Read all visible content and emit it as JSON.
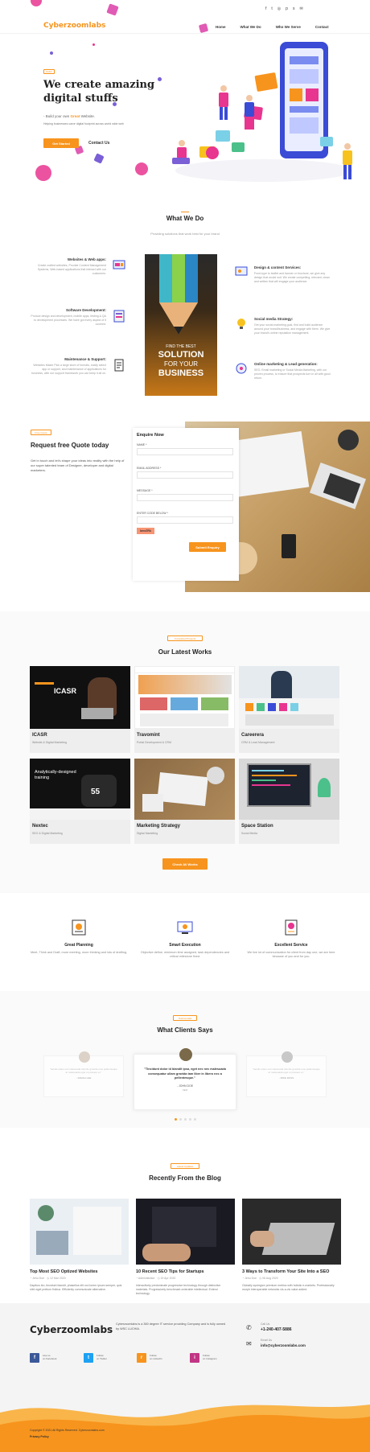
{
  "header": {
    "logo": "Cyberzoomlabs",
    "nav": [
      "Home",
      "What We Do",
      "Who We Serve",
      "Contact"
    ],
    "social_icons": [
      "facebook-icon",
      "twitter-icon",
      "instagram-icon",
      "pinterest-icon",
      "skype-icon",
      "email-icon"
    ]
  },
  "hero": {
    "tag": "Hello!",
    "title_line1": "We create amazing",
    "title_line2": "digital stuffs",
    "subtitle_prefix": "- Build your own",
    "subtitle_highlight": "Great",
    "subtitle_suffix": "Website.",
    "description": "Helping businesses carve digital footprint across world wide web",
    "cta_primary": "Get Started",
    "cta_secondary": "Contact Us"
  },
  "what_we_do": {
    "title": "What We Do",
    "subtitle": "Providing solutions that work best for your brand",
    "image_text": [
      "FIND THE BEST",
      "SOLUTION",
      "FOR YOUR",
      "BUSINESS"
    ],
    "left_services": [
      {
        "title": "Websites & Web apps:",
        "desc": "Create crafted websites, Provide Content Management Systems, Web-based applications that interact with our customers."
      },
      {
        "title": "Software Development:",
        "desc": "Product design and development, mobile apps, testing & QA to development processes. We have got every aspect of it covered."
      },
      {
        "title": "Maintenance & Support:",
        "desc": "Websites Maker Pick a large store of formats, easily select app or support, and maintenance of applications for business, with our support framework you can keep it all on."
      }
    ],
    "right_services": [
      {
        "title": "Design & content Services:",
        "desc": "Front-type to leaflet and banner or brochure, we give any design that would suit. We create compelling, relevant, clean and written that will engage your audience."
      },
      {
        "title": "Social media Strategy:",
        "desc": "Get your social marketing goal, find and build audience around your brand/business, and engage with them. We give your brand's online reputation management."
      },
      {
        "title": "Online marketing & Lead generation:",
        "desc": "SEO, Email marketing or Social Media Marketing, with our proven process, to ensure that prospects turn in all with good return."
      }
    ]
  },
  "quote": {
    "tag": "Free Quote",
    "title": "Request free Quote today",
    "description": "Get in touch and let's shape your ideas into reality with the help of our super talented team of Designer, developer and digital marketers.",
    "form_title": "Enquire Now",
    "fields": [
      "Name *",
      "Email Address *",
      "Message *",
      "Enter Code Below *"
    ],
    "captcha": "bmeZRk",
    "submit": "Submit Enquiry"
  },
  "works": {
    "tag": "Completed Projects",
    "title": "Our Latest Works",
    "items": [
      {
        "title": "ICASR",
        "subtitle": "Website & Digital Marketing"
      },
      {
        "title": "Travomint",
        "subtitle": "Portal Development & CRM"
      },
      {
        "title": "Careerera",
        "subtitle": "CRM & Lead Management"
      },
      {
        "title": "Nextec",
        "subtitle": "SEO & Digital Marketing"
      },
      {
        "title": "Marketing Strategy",
        "subtitle": "Digital Marketing"
      },
      {
        "title": "Space Station",
        "subtitle": "Social Media"
      }
    ],
    "thumb_text": {
      "icasr": "ICASR",
      "nextec_training": "Analytically-designed training"
    },
    "cta": "Check All Works"
  },
  "features": [
    {
      "title": "Great Planning",
      "desc": "Meet, Think and Draft, more meeting, more thinking and lots of drafting."
    },
    {
      "title": "Smart Execution",
      "desc": "Objective define, minimum time assigned, task dependencies and critical milestone fixed."
    },
    {
      "title": "Excellent Service",
      "desc": "We live lot of communication for client from day one, we are here because of you and for you."
    }
  ],
  "testimonials": {
    "tag": "Testimonials",
    "title": "What Clients Says",
    "items": [
      {
        "quote": "\"Iaculis etiam est malesuada lobortis gravida eros pellentesque at malesuada eget ut posuere et.\"",
        "name": "- SARAH LEE",
        "role": "Designer"
      },
      {
        "quote": "\"Tincidunt dolor id blandit ipsa, eget nec nec malesuada consequatur ullam gravida tam liber in libero nec a pellentesque.\"",
        "name": "- JOHN DOE",
        "role": "CEO"
      },
      {
        "quote": "\"Iaculis etiam est malesuada lobortis gravida eros pellentesque at malesuada eget ut posuere et.\"",
        "name": "- MIKE ROSS",
        "role": "Manager"
      }
    ]
  },
  "blog": {
    "tag": "Latest Updates",
    "title": "Recently From the Blog",
    "posts": [
      {
        "title": "Top Most SEO Optized Websites",
        "author": "Jehu Doe",
        "date": "12 Mar 2020",
        "desc": "Dapibus leo, tincidunt blandit, phasellus elit orci lorem ipsum semper, quis nibh eget pretium finibus. Efficiently communicate alternative."
      },
      {
        "title": "10 Recent SEO Tips for Startups",
        "author": "Administrator",
        "date": "19 Apr 2020",
        "desc": "Interactively predominate progressive technology through distinctive materials. Progressively benchmark orderable intellectual. Extend technology."
      },
      {
        "title": "3 Ways to Transform Your Site Into a SEO",
        "author": "Jehu Doe",
        "date": "06 Aug 2020",
        "desc": "Globally synergize premium metrics with holistic e-markets. Professionally morph interoperable networks vis-a-vis value added."
      }
    ]
  },
  "footer": {
    "logo": "Cyberzoomlabs",
    "about": "Cyberzoomlabs is a 360 degree IT service providing Company and is fully owned by WSC LUCHIA.",
    "call_label": "Call Us",
    "phone": "+1-240-407-5886",
    "email_label": "Email Us",
    "email": "info@cyberzoomlabs.com",
    "social": [
      {
        "icon": "f",
        "line1": "Like us",
        "line2": "on Facebook",
        "color": "#3b5998"
      },
      {
        "icon": "t",
        "line1": "Follow",
        "line2": "on Twitter",
        "color": "#1da1f2"
      },
      {
        "icon": "r",
        "line1": "Follow",
        "line2": "on LinkedIn",
        "color": "#f7941d"
      },
      {
        "icon": "i",
        "line1": "Follow",
        "line2": "on Instagram",
        "color": "#c13584"
      }
    ],
    "copyright": "Copyright © 2021 All Rights Reserved. Cyberzoomlabs.com",
    "privacy": "Privacy Policy"
  },
  "colors": {
    "accent": "#f7941d",
    "magenta": "#e8358f",
    "purple": "#7a5fd6"
  }
}
